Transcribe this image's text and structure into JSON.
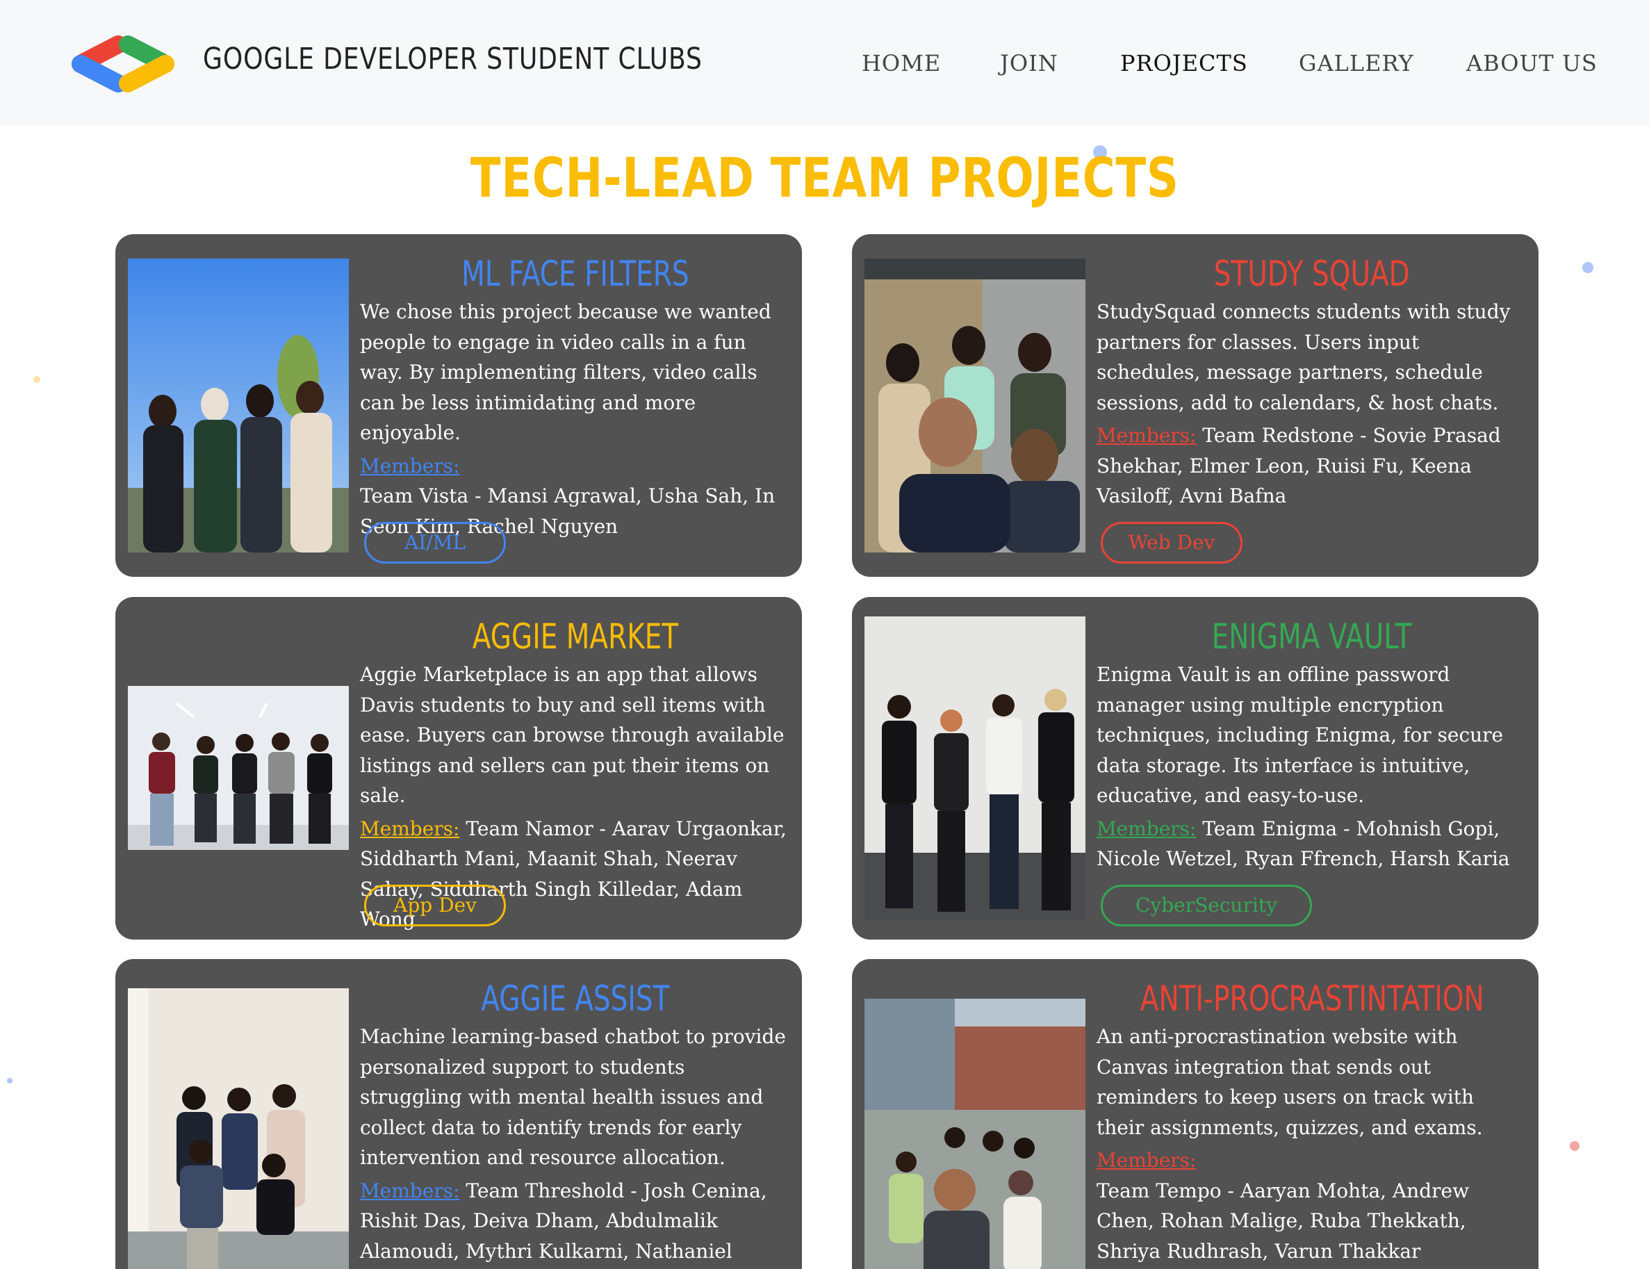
{
  "brand": {
    "name": "GOOGLE DEVELOPER STUDENT CLUBS"
  },
  "nav": {
    "items": [
      "HOME",
      "JOIN",
      "PROJECTS",
      "GALLERY",
      "ABOUT US"
    ],
    "active": "PROJECTS"
  },
  "page": {
    "title": "TECH-LEAD TEAM PROJECTS"
  },
  "colors": {
    "blue": "#4285f4",
    "red": "#ea4335",
    "yellow": "#fbbc05",
    "green": "#34a853",
    "card": "#525252",
    "header": "#f7f8fa"
  },
  "projects": [
    {
      "title": "ML FACE FILTERS",
      "color": "#4285f4",
      "description": "We chose this project because we wanted people to engage in video calls in a fun way. By implementing filters, video calls can be less intimidating and more enjoyable.",
      "members_label": "Members:",
      "members": "Team Vista - Mansi Agrawal, Usha Sah, In Seon Kim, Rachel Nguyen",
      "tag": "AI/ML"
    },
    {
      "title": "STUDY SQUAD",
      "color": "#ea4335",
      "description": "StudySquad connects students with study partners for classes. Users input schedules, message partners, schedule sessions, add to calendars, & host chats.",
      "members_label": "Members:",
      "members": "Team Redstone - Sovie Prasad Shekhar, Elmer Leon, Ruisi Fu, Keena Vasiloff, Avni Bafna",
      "tag": "Web Dev"
    },
    {
      "title": "AGGIE MARKET",
      "color": "#fbbc05",
      "description": "Aggie Marketplace is an app that allows Davis students to buy and sell items with ease. Buyers can browse through available listings and sellers can put their items on sale.",
      "members_label": "Members:",
      "members": "Team Namor - Aarav Urgaonkar, Siddharth Mani, Maanit Shah, Neerav Sahay, Siddharth Singh Killedar, Adam Wong",
      "tag": "App Dev"
    },
    {
      "title": "ENIGMA VAULT",
      "color": "#34a853",
      "description": "Enigma Vault is an offline password manager using multiple encryption techniques, including Enigma, for secure data storage. Its interface is intuitive, educative, and easy-to-use.",
      "members_label": "Members:",
      "members": "Team Enigma - Mohnish Gopi, Nicole Wetzel, Ryan Ffrench, Harsh Karia",
      "tag": "CyberSecurity"
    },
    {
      "title": "AGGIE ASSIST",
      "color": "#4285f4",
      "description": "Machine learning-based chatbot to provide personalized support to students struggling with mental health issues and collect data to identify trends for early intervention and resource allocation.",
      "members_label": "Members:",
      "members": "Team Threshold - Josh Cenina, Rishit Das, Deiva Dham, Abdulmalik Alamoudi, Mythri Kulkarni, Nathaniel Maffly"
    },
    {
      "title": "ANTI-PROCRASTINTATION",
      "color": "#ea4335",
      "description": "An anti-procrastination website with Canvas integration that sends out reminders to keep users on track with their assignments, quizzes, and exams.",
      "members_label": "Members:",
      "members": "Team Tempo - Aaryan Mohta, Andrew Chen, Rohan Malige, Ruba Thekkath, Shriya Rudhrash, Varun Thakkar"
    }
  ]
}
